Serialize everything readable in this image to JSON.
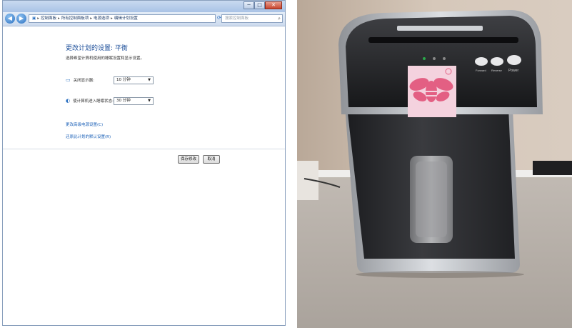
{
  "window": {
    "title": "",
    "controls": [
      "─",
      "□",
      "✕"
    ]
  },
  "nav": {
    "back_icon": "back-arrow-icon",
    "forward_icon": "forward-arrow-icon",
    "breadcrumbs": [
      "控制面板",
      "所有控制面板项",
      "电源选项",
      "编辑计划设置"
    ],
    "search_placeholder": "搜索控制面板"
  },
  "page": {
    "heading": "更改计划的设置: 平衡",
    "subheading": "选择希望计算机使用的睡眠设置和显示设置。",
    "settings": [
      {
        "label": "关闭显示器:",
        "value": "10 分钟",
        "icon": "monitor-icon"
      },
      {
        "label": "使计算机进入睡眠状态:",
        "value": "30 分钟",
        "icon": "moon-icon"
      }
    ],
    "links": [
      "更改高级电源设置(C)",
      "还原此计划的默认设置(R)"
    ],
    "buttons": {
      "save": "保存修改",
      "cancel": "取消"
    }
  },
  "photo": {
    "description_icon": "paper-shredder-photo",
    "panel_labels": [
      "Forward",
      "Reverse",
      "Power"
    ],
    "colors": {
      "body": "#2c2d30",
      "trim": "#b9bcc1",
      "wall": "#cfbfb0",
      "floor": "#b7afa8",
      "logo_bg": "#f4d2de",
      "logo": "#e35f83"
    }
  }
}
